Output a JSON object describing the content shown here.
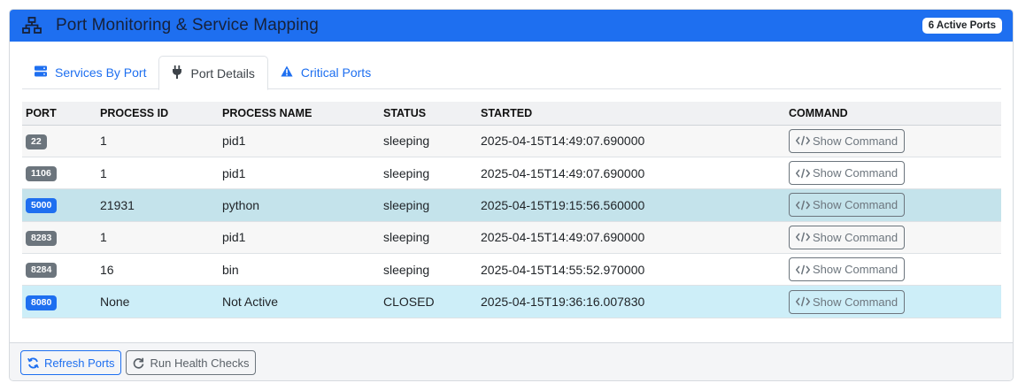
{
  "header": {
    "title": "Port Monitoring & Service Mapping",
    "active_badge": "6 Active Ports",
    "icon": "network-icon"
  },
  "tabs": [
    {
      "label": "Services By Port",
      "icon": "server-icon",
      "active": false
    },
    {
      "label": "Port Details",
      "icon": "plug-icon",
      "active": true
    },
    {
      "label": "Critical Ports",
      "icon": "warning-icon",
      "active": false
    }
  ],
  "table": {
    "columns": [
      "PORT",
      "PROCESS ID",
      "PROCESS NAME",
      "STATUS",
      "STARTED",
      "COMMAND"
    ],
    "command_button_label": "Show Command",
    "rows": [
      {
        "port": "22",
        "pid": "1",
        "name": "pid1",
        "status": "sleeping",
        "started": "2025-04-15T14:49:07.690000"
      },
      {
        "port": "1106",
        "pid": "1",
        "name": "pid1",
        "status": "sleeping",
        "started": "2025-04-15T14:49:07.690000"
      },
      {
        "port": "5000",
        "pid": "21931",
        "name": "python",
        "status": "sleeping",
        "started": "2025-04-15T19:15:56.560000"
      },
      {
        "port": "8283",
        "pid": "1",
        "name": "pid1",
        "status": "sleeping",
        "started": "2025-04-15T14:49:07.690000"
      },
      {
        "port": "8284",
        "pid": "16",
        "name": "bin",
        "status": "sleeping",
        "started": "2025-04-15T14:55:52.970000"
      },
      {
        "port": "8080",
        "pid": "None",
        "name": "Not Active",
        "status": "CLOSED",
        "started": "2025-04-15T19:36:16.007830"
      }
    ]
  },
  "footer": {
    "refresh_label": "Refresh Ports",
    "health_label": "Run Health Checks"
  },
  "colors": {
    "header_bg": "#1e6ff0",
    "accent": "#1e6ff0",
    "secondary": "#6c757d",
    "highlight_row": "#c4e3eb",
    "highlight_row_closed": "#cdeef8"
  }
}
